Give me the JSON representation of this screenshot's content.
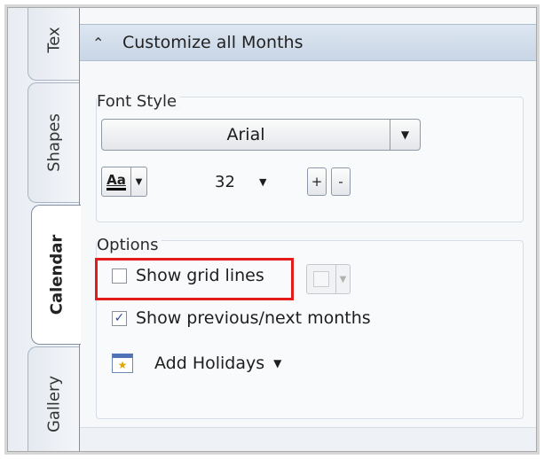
{
  "tabs": [
    {
      "label": "Tex",
      "active": false
    },
    {
      "label": "Shapes",
      "active": false
    },
    {
      "label": "Calendar",
      "active": true
    },
    {
      "label": "Gallery",
      "active": false
    }
  ],
  "panel": {
    "title": "Customize all Months",
    "collapse_icon": "chevron-up-icon"
  },
  "font_style": {
    "label": "Font Style",
    "font_value": "Arial",
    "size_value": "32",
    "plus_label": "+",
    "minus_label": "-",
    "aa_label": "Aa"
  },
  "options": {
    "label": "Options",
    "show_grid_lines": {
      "label": "Show grid lines",
      "checked": false
    },
    "show_prev_next": {
      "label": "Show previous/next months",
      "checked": true
    },
    "add_holidays": {
      "label": "Add Holidays",
      "icon": "calendar-star-icon"
    }
  },
  "colors": {
    "highlight": "#e41b1b",
    "header_bg": "#d3deeb",
    "checkmark": "#2a4e9a"
  }
}
